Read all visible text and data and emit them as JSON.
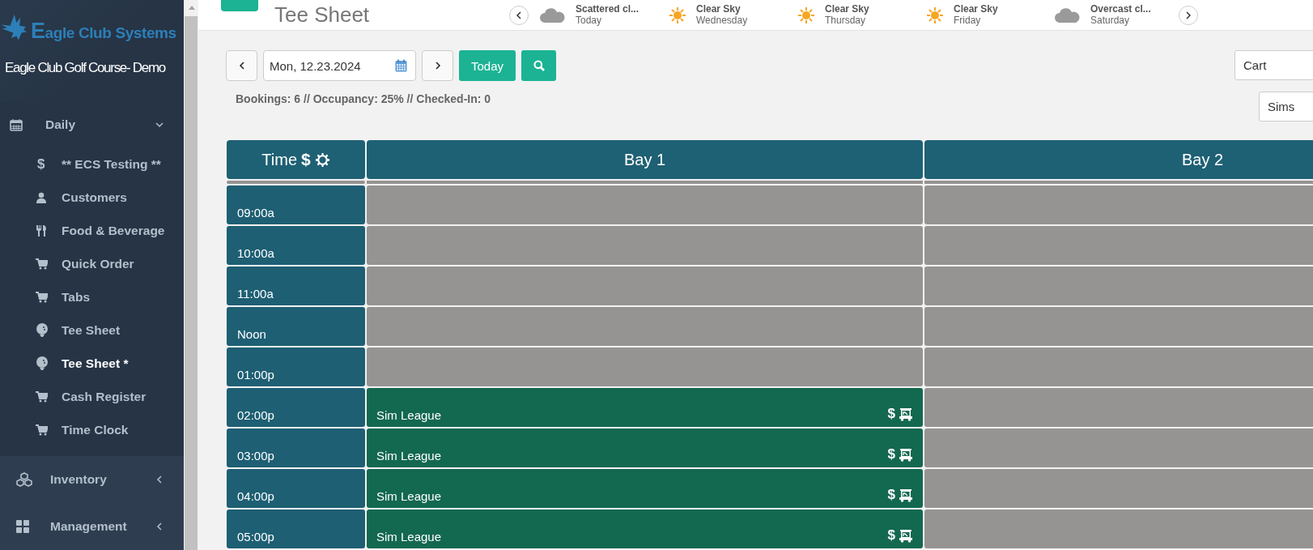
{
  "sidebar": {
    "logo_text": "Eagle Club Systems",
    "club_name": "Eagle Club Golf Course- Demo",
    "sections": [
      {
        "label": "Daily",
        "expanded": true,
        "children": [
          {
            "label": "** ECS Testing **",
            "glyph": "$",
            "selected": false
          },
          {
            "label": "Customers",
            "selected": false
          },
          {
            "label": "Food & Beverage",
            "selected": false
          },
          {
            "label": "Quick Order",
            "selected": false
          },
          {
            "label": "Tabs",
            "selected": false
          },
          {
            "label": "Tee Sheet",
            "selected": false
          },
          {
            "label": "Tee Sheet *",
            "selected": true
          },
          {
            "label": "Cash Register",
            "selected": false
          },
          {
            "label": "Time Clock",
            "selected": false
          }
        ]
      },
      {
        "label": "Inventory",
        "expanded": false
      },
      {
        "label": "Management",
        "expanded": false
      }
    ]
  },
  "header": {
    "title": "Tee Sheet",
    "forecast": [
      {
        "condition": "Scattered cl...",
        "day": "Today",
        "kind": "cloud"
      },
      {
        "condition": "Clear Sky",
        "day": "Wednesday",
        "kind": "sun"
      },
      {
        "condition": "Clear Sky",
        "day": "Thursday",
        "kind": "sun"
      },
      {
        "condition": "Clear Sky",
        "day": "Friday",
        "kind": "sun"
      },
      {
        "condition": "Overcast cl...",
        "day": "Saturday",
        "kind": "cloud"
      }
    ]
  },
  "toolbar": {
    "date": "Mon, 12.23.2024",
    "today_button": "Today",
    "stats": "Bookings: 6 // Occupancy: 25% // Checked-In: 0",
    "filters": [
      "Cart",
      "Sims"
    ]
  },
  "table": {
    "columns": [
      {
        "label": "Time",
        "glyph": "$"
      },
      {
        "label": "Bay 1"
      },
      {
        "label": "Bay 2"
      }
    ],
    "rows": [
      {
        "time": "09:00a",
        "cells": [
          {
            "kind": "empty"
          },
          {
            "kind": "empty"
          }
        ]
      },
      {
        "time": "10:00a",
        "cells": [
          {
            "kind": "empty"
          },
          {
            "kind": "empty"
          }
        ]
      },
      {
        "time": "11:00a",
        "cells": [
          {
            "kind": "empty"
          },
          {
            "kind": "empty"
          }
        ]
      },
      {
        "time": "Noon",
        "cells": [
          {
            "kind": "empty"
          },
          {
            "kind": "empty"
          }
        ]
      },
      {
        "time": "01:00p",
        "cells": [
          {
            "kind": "empty"
          },
          {
            "kind": "empty"
          }
        ]
      },
      {
        "time": "02:00p",
        "cells": [
          {
            "kind": "booking",
            "label": "Sim League",
            "glyph": "$",
            "cart": true
          },
          {
            "kind": "empty"
          }
        ]
      },
      {
        "time": "03:00p",
        "cells": [
          {
            "kind": "booking",
            "label": "Sim League",
            "glyph": "$",
            "cart": true
          },
          {
            "kind": "empty"
          }
        ]
      },
      {
        "time": "04:00p",
        "cells": [
          {
            "kind": "booking",
            "label": "Sim League",
            "glyph": "$",
            "cart": true
          },
          {
            "kind": "empty"
          }
        ]
      },
      {
        "time": "05:00p",
        "cells": [
          {
            "kind": "booking",
            "label": "Sim League",
            "glyph": "$",
            "cart": true
          },
          {
            "kind": "empty"
          }
        ]
      }
    ]
  }
}
